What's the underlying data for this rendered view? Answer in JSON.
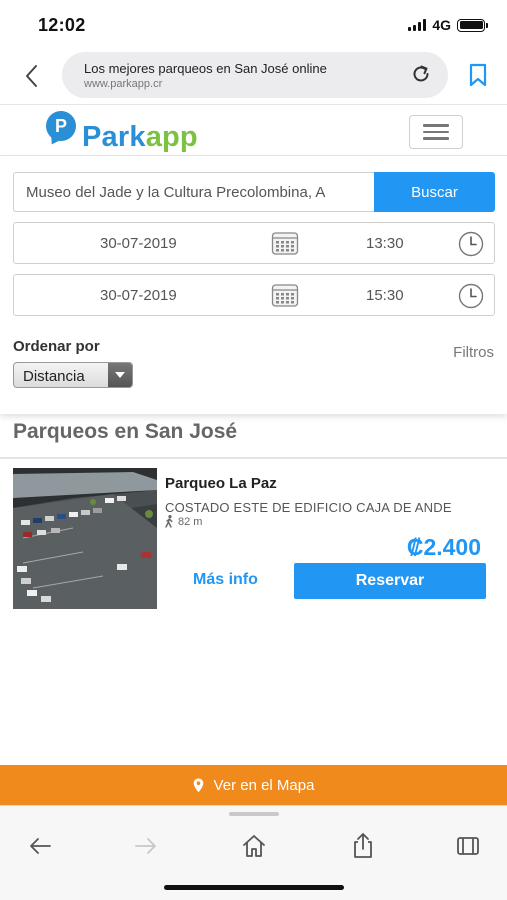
{
  "status_bar": {
    "time": "12:02",
    "network": "4G"
  },
  "browser": {
    "page_title": "Los mejores parqueos en San José online",
    "host": "www.parkapp.cr"
  },
  "site": {
    "logo_mark": "P",
    "logo_part1": "Park",
    "logo_part2": "app",
    "brand_blue": "#2b8fd6",
    "brand_green": "#7cc242"
  },
  "search": {
    "destination": "Museo del Jade y la Cultura Precolombina, A",
    "button_label": "Buscar",
    "entry": {
      "date": "30-07-2019",
      "time": "13:30"
    },
    "exit": {
      "date": "30-07-2019",
      "time": "15:30"
    },
    "order_label": "Ordenar por",
    "order_value": "Distancia",
    "filters_label": "Filtros"
  },
  "results": {
    "section_title": "Parqueos en San José",
    "items": [
      {
        "name": "Parqueo La Paz",
        "address": "COSTADO ESTE DE EDIFICIO CAJA DE ANDE",
        "distance": "82 m",
        "price": "₡2.400",
        "more_info_label": "Más info",
        "reserve_label": "Reservar"
      }
    ]
  },
  "map_button": {
    "label": "Ver en el Mapa",
    "color": "#f08a1d"
  },
  "accent_color": "#2196f3",
  "icons": {
    "back": "chevron-left-icon",
    "reload": "reload-icon",
    "bookmark": "bookmark-icon",
    "calendar": "calendar-icon",
    "clock": "clock-icon",
    "walk": "walking-person-icon",
    "map_pin": "map-pin-icon",
    "toolbar": [
      "back-arrow-icon",
      "forward-arrow-icon",
      "home-icon",
      "share-icon",
      "tabs-icon"
    ]
  }
}
